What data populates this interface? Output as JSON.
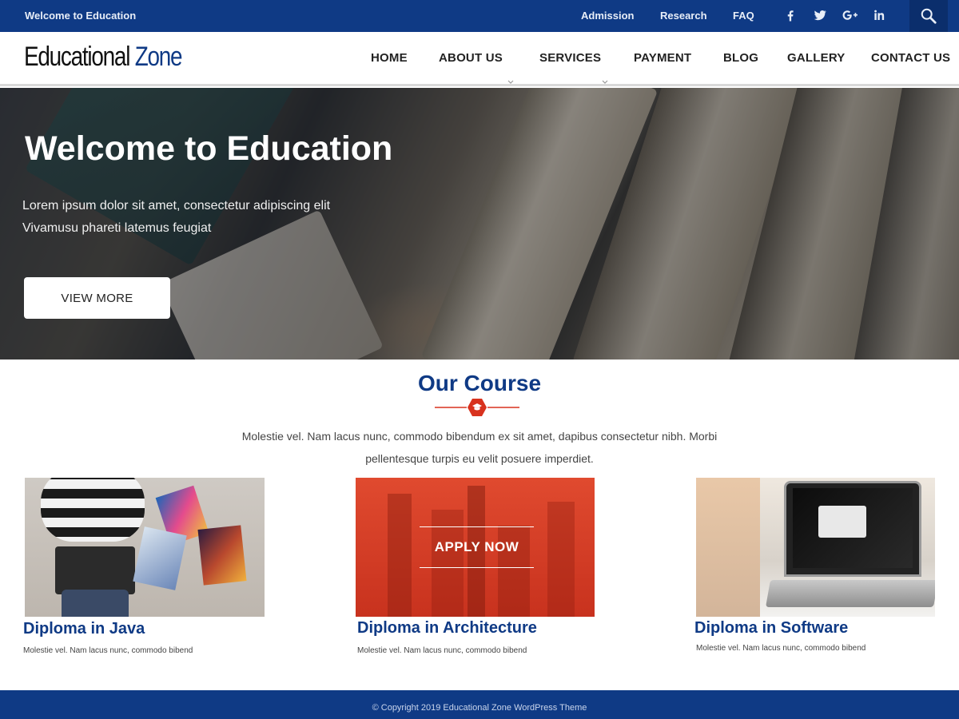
{
  "topbar": {
    "welcome": "Welcome to Education",
    "links": [
      "Admission",
      "Research",
      "FAQ"
    ],
    "social_icons": [
      "facebook-icon",
      "twitter-icon",
      "google-plus-icon",
      "linkedin-icon"
    ],
    "search_icon": "search-icon"
  },
  "header": {
    "logo_part1": "Educational",
    "logo_part2": "Zone",
    "nav": [
      "HOME",
      "ABOUT US",
      "SERVICES",
      "PAYMENT",
      "BLOG",
      "GALLERY",
      "CONTACT US"
    ]
  },
  "hero": {
    "title": "Welcome to Education",
    "subtitle_line1": "Lorem ipsum dolor sit amet, consectetur adipiscing elit",
    "subtitle_line2": "Vivamusu phareti latemus feugiat",
    "button": "VIEW MORE"
  },
  "courses": {
    "title": "Our Course",
    "description_line1": "Molestie vel. Nam lacus nunc, commodo bibendum ex sit amet, dapibus consectetur nibh. Morbi",
    "description_line2": "pellentesque turpis eu velit posuere imperdiet.",
    "items": [
      {
        "title": "Diploma in Java",
        "text": "Molestie vel. Nam lacus nunc, commodo bibend"
      },
      {
        "title": "Diploma in Architecture",
        "text": "Molestie vel. Nam lacus nunc, commodo bibend",
        "overlay_button": "APPLY NOW"
      },
      {
        "title": "Diploma in Software",
        "text": "Molestie vel. Nam lacus nunc, commodo bibend"
      }
    ]
  },
  "footer": {
    "copyright": "© Copyright 2019 Educational Zone WordPress Theme"
  },
  "colors": {
    "primary": "#0f3a85",
    "accent": "#d8321e",
    "white": "#ffffff"
  }
}
